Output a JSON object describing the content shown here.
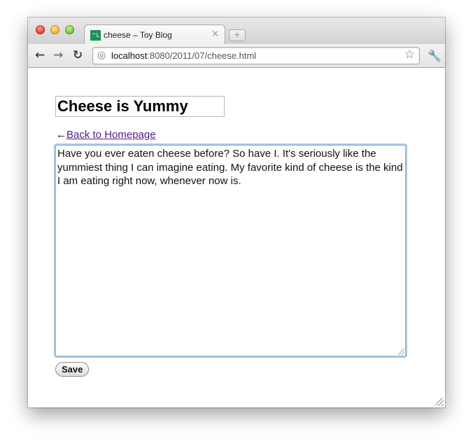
{
  "browser": {
    "tab": {
      "favicon_text": "^L",
      "title": "cheese – Toy Blog",
      "close_glyph": "×"
    },
    "new_tab_glyph": "+",
    "toolbar": {
      "back_icon": "←",
      "forward_icon": "→",
      "reload_icon": "↻",
      "url_host": "localhost",
      "url_path": ":8080/2011/07/cheese.html",
      "globe_icon": "◎",
      "star_icon": "☆",
      "wrench_icon": "🔧"
    }
  },
  "post": {
    "title_value": "Cheese is Yummy",
    "back_arrow": "←",
    "back_link": "Back to Homepage",
    "body_text": "Have you ever eaten cheese before? So have I. It's seriously like the yummiest thing I can imagine eating. My favorite kind of cheese is the kind I am eating right now, whenever now is.",
    "save_label": "Save"
  }
}
